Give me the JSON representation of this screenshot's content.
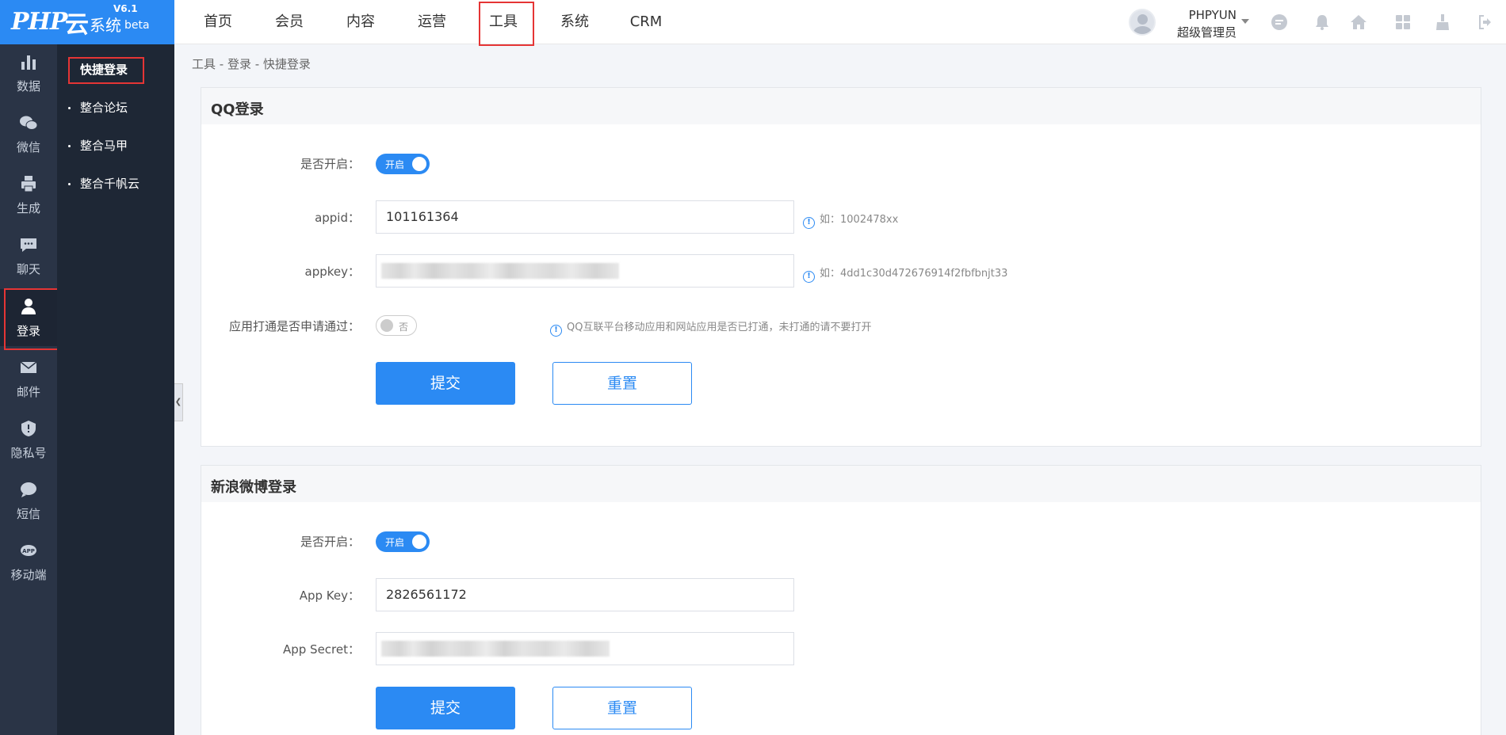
{
  "logo": {
    "php": "PHP",
    "yun": "云",
    "system": "系统",
    "version": "V6.1",
    "beta": "beta"
  },
  "topnav": [
    "首页",
    "会员",
    "内容",
    "运营",
    "工具",
    "系统",
    "CRM"
  ],
  "topnav_active": "工具",
  "user": {
    "name": "PHPYUN",
    "role": "超级管理员"
  },
  "icon_sidebar": [
    {
      "label": "数据",
      "icon": "bar-chart-icon"
    },
    {
      "label": "微信",
      "icon": "wechat-icon"
    },
    {
      "label": "生成",
      "icon": "printer-icon"
    },
    {
      "label": "聊天",
      "icon": "chat-icon"
    },
    {
      "label": "登录",
      "icon": "user-icon"
    },
    {
      "label": "邮件",
      "icon": "mail-icon"
    },
    {
      "label": "隐私号",
      "icon": "shield-icon"
    },
    {
      "label": "短信",
      "icon": "message-icon"
    },
    {
      "label": "移动端",
      "icon": "app-icon"
    }
  ],
  "submenu": [
    "快捷登录",
    "整合论坛",
    "整合马甲",
    "整合千帆云"
  ],
  "breadcrumb": "工具 - 登录 - 快捷登录",
  "qq": {
    "title": "QQ登录",
    "enable_label": "是否开启：",
    "enable_value": "开启",
    "appid_label": "appid：",
    "appid_value": "101161364",
    "appid_hint": "如：1002478xx",
    "appkey_label": "appkey：",
    "appkey_hint": "如：4dd1c30d472676914f2fbfbnjt33",
    "unionid_label": "应用打通是否申请通过：",
    "unionid_value": "否",
    "unionid_hint": "QQ互联平台移动应用和网站应用是否已打通，未打通的请不要打开",
    "submit": "提交",
    "reset": "重置"
  },
  "weibo": {
    "title": "新浪微博登录",
    "enable_label": "是否开启：",
    "enable_value": "开启",
    "appkey_label": "App Key：",
    "appkey_value": "2826561172",
    "secret_label": "App Secret：",
    "submit": "提交",
    "reset": "重置"
  }
}
